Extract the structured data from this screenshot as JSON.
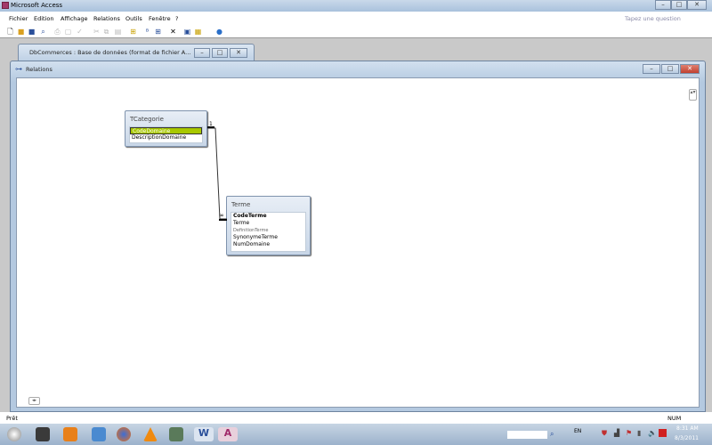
{
  "app": {
    "title": "Microsoft Access",
    "help_placeholder": "Tapez une question"
  },
  "menu": [
    "Fichier",
    "Edition",
    "Affichage",
    "Relations",
    "Outils",
    "Fenêtre",
    "?"
  ],
  "db_window": {
    "title": "DbCommerces : Base de données (format de fichier A..."
  },
  "relations_window": {
    "title": "Relations"
  },
  "tables": [
    {
      "name": "TCategorie",
      "fields": [
        "CodeDomaine",
        "DescriptionDomaine"
      ],
      "selected": "CodeDomaine"
    },
    {
      "name": "Terme",
      "fields": [
        "CodeTerme",
        "Terme",
        "DefinitionTerme",
        "SynonymeTerme",
        "NumDomaine"
      ]
    }
  ],
  "relationship": {
    "one": "1",
    "many": "∞"
  },
  "status": {
    "left": "Prêt",
    "right": "NUM"
  },
  "tray": {
    "lang": "EN",
    "time": "8:31 AM",
    "date": "8/3/2011"
  },
  "colors": {
    "selected_field": "#a8c800"
  }
}
